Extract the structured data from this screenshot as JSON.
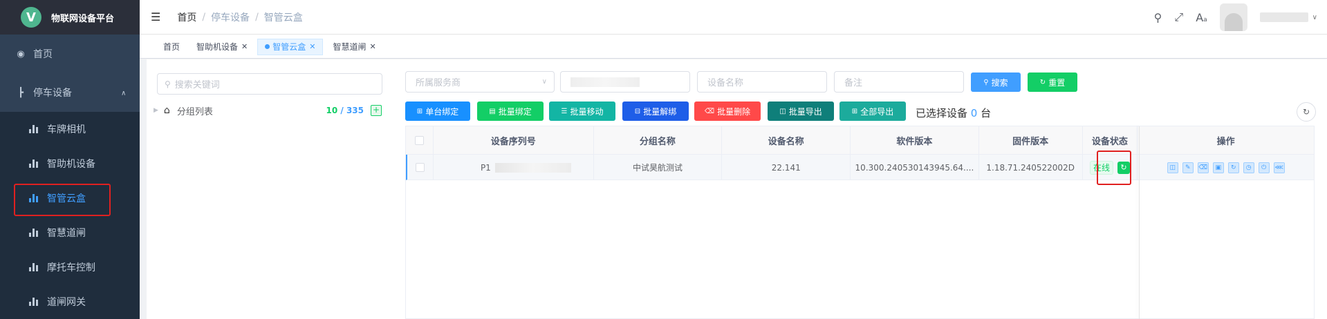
{
  "app": {
    "logo_letter": "V",
    "title": "物联网设备平台"
  },
  "sidebar": {
    "home": "首页",
    "parking": "停车设备",
    "sub": [
      "车牌相机",
      "智助机设备",
      "智管云盒",
      "智慧道闸",
      "摩托车控制",
      "道闸网关"
    ]
  },
  "breadcrumb": [
    "首页",
    "停车设备",
    "智管云盒"
  ],
  "tags": [
    "首页",
    "智助机设备",
    "智管云盒",
    "智慧道闸"
  ],
  "tree": {
    "search_placeholder": "搜索关键词",
    "root_label": "分组列表",
    "count_online": "10",
    "count_sep": "/",
    "count_total": "335"
  },
  "filters": {
    "provider_placeholder": "所属服务商",
    "name_placeholder": "设备名称",
    "remark_placeholder": "备注"
  },
  "buttons": {
    "search": "搜索",
    "reset": "重置",
    "single_bind": "单台绑定",
    "batch_bind": "批量绑定",
    "batch_move": "批量移动",
    "batch_unbind": "批量解绑",
    "batch_delete": "批量删除",
    "batch_export": "批量导出",
    "export_all": "全部导出"
  },
  "selected": {
    "prefix": "已选择设备",
    "count": "0",
    "suffix": "台"
  },
  "table": {
    "headers": [
      "设备序列号",
      "分组名称",
      "设备名称",
      "软件版本",
      "固件版本",
      "设备状态",
      "操作"
    ],
    "rows": [
      {
        "serial_prefix": "P1",
        "group": "中试昊航测试",
        "name": "22.141",
        "software": "10.300.240530143945.64....",
        "firmware": "1.18.71.240522002D",
        "status": "在线"
      }
    ]
  },
  "colors": {
    "primary": "#409eff",
    "success": "#13ce66",
    "danger": "#ff4949",
    "teal": "#13b5a4",
    "sidebar": "#304156"
  }
}
